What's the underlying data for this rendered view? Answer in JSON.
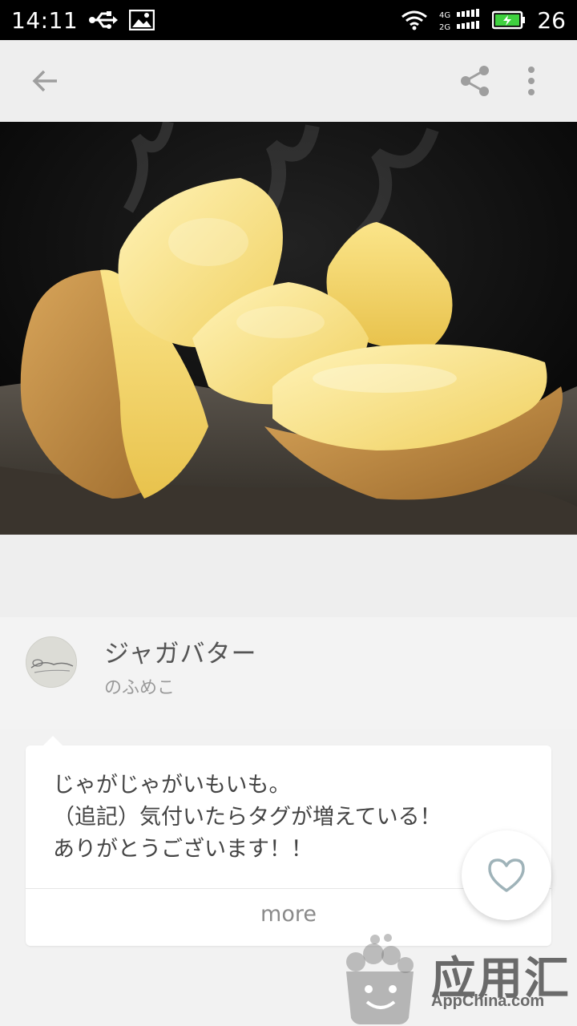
{
  "status_bar": {
    "time": "14:11",
    "battery_level": "26",
    "network_top": "4G",
    "network_bottom": "2G",
    "icons": [
      "usb-icon",
      "image-icon",
      "wifi-icon",
      "signal-icon",
      "battery-charging-icon"
    ]
  },
  "toolbar": {
    "icons": [
      "back-arrow-icon",
      "share-icon",
      "more-vert-icon"
    ]
  },
  "work": {
    "title": "ジャガバター",
    "author": "のふめこ",
    "caption": [
      "じゃがじゃがいもいも。",
      "（追記）気付いたらタグが増えている！",
      "ありがとうございます！！"
    ],
    "more_label": "more"
  },
  "watermark": {
    "brand": "应用汇",
    "site": "AppChina.com"
  },
  "colors": {
    "status_bar": "#000000",
    "toolbar": "#eeeeee",
    "background": "#f2f2f2",
    "card": "#ffffff",
    "icon": "#9e9e9e",
    "heart": "#9fb3b9"
  }
}
